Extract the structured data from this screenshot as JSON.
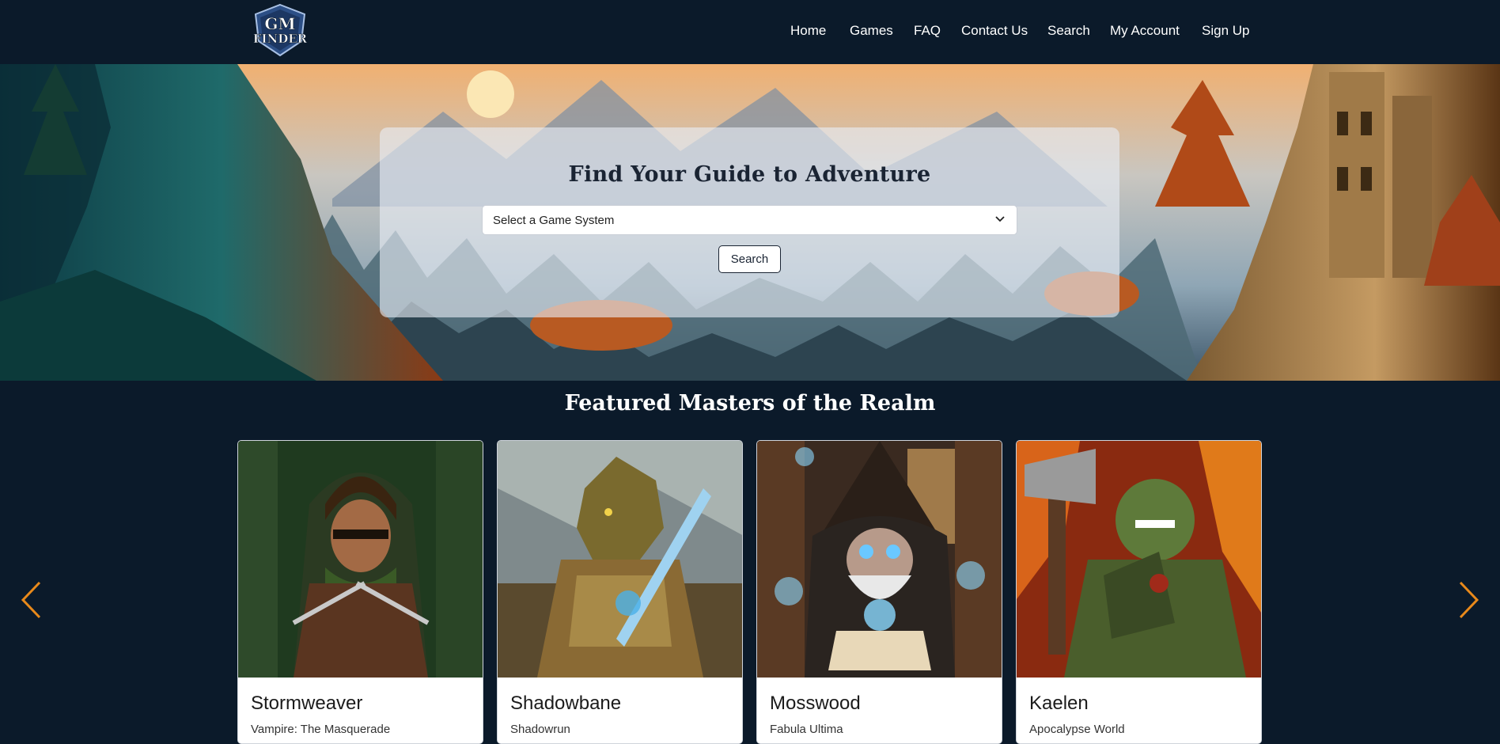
{
  "navbar": {
    "logo": {
      "top_text": "GM",
      "bottom_text": "FINDER"
    },
    "links": [
      {
        "label": "Home"
      },
      {
        "label": "Games"
      },
      {
        "label": "FAQ"
      },
      {
        "label": "Contact Us"
      },
      {
        "label": "Search"
      },
      {
        "label": "My Account"
      },
      {
        "label": "Sign Up"
      }
    ]
  },
  "hero": {
    "title": "Find Your Guide to Adventure",
    "select_placeholder": "Select a Game System",
    "search_button": "Search"
  },
  "featured": {
    "title": "Featured Masters of the Realm",
    "cards": [
      {
        "name": "Stormweaver",
        "system": "Vampire: The Masquerade"
      },
      {
        "name": "Shadowbane",
        "system": "Shadowrun"
      },
      {
        "name": "Mosswood",
        "system": "Fabula Ultima"
      },
      {
        "name": "Kaelen",
        "system": "Apocalypse World"
      }
    ]
  },
  "colors": {
    "page_bg": "#0b1a2a",
    "arrow_accent": "#e8891a",
    "panel_bg": "#e8eef6"
  },
  "icons": {
    "select": "chevron-down-icon",
    "prev": "chevron-left-icon",
    "next": "chevron-right-icon"
  }
}
